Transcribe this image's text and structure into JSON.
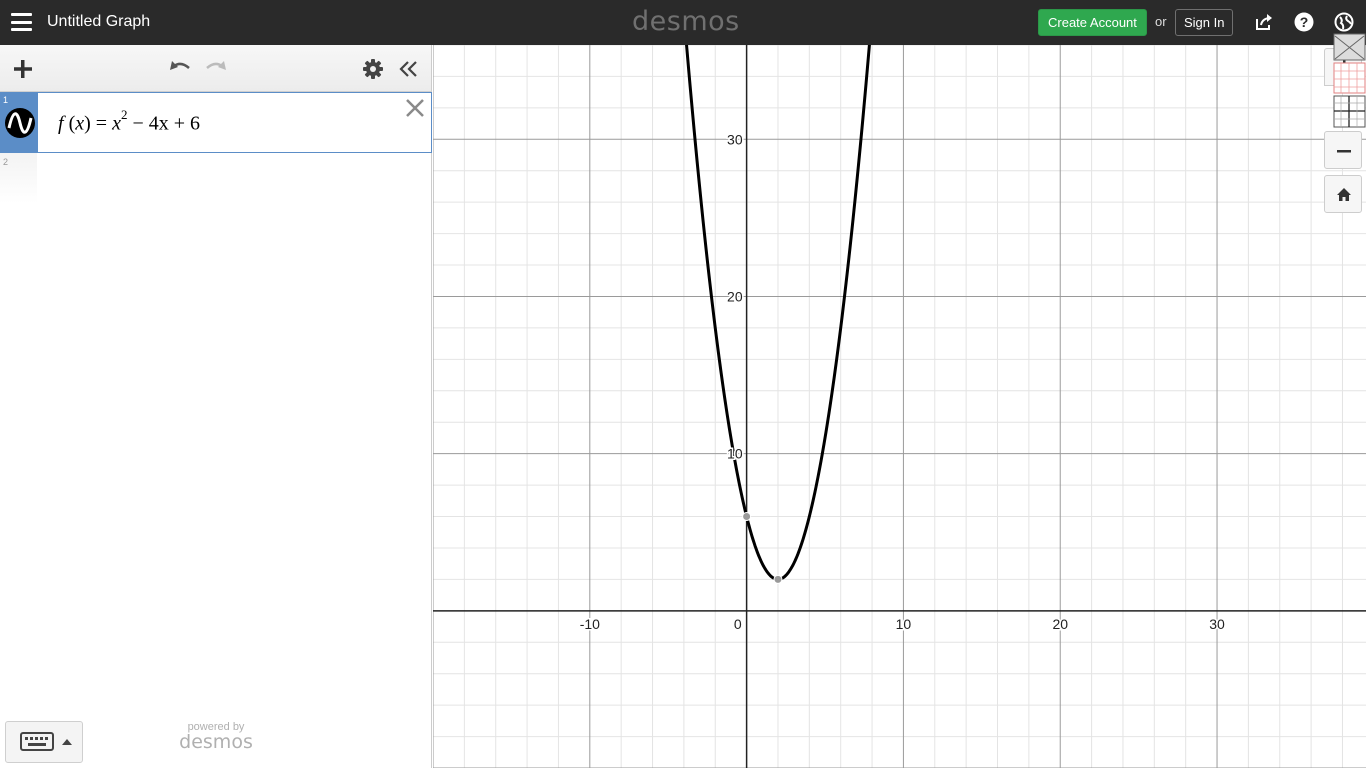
{
  "header": {
    "title": "Untitled Graph",
    "brand": "desmos",
    "create_account_label": "Create Account",
    "or_label": "or",
    "sign_in_label": "Sign In",
    "icons": [
      "hamburger-menu-icon",
      "share-icon",
      "help-icon",
      "globe-icon"
    ]
  },
  "panel": {
    "toolbar_icons": [
      "add-icon",
      "undo-icon",
      "redo-icon",
      "settings-gear-icon",
      "collapse-panel-icon"
    ],
    "expressions": [
      {
        "index": "1",
        "lhs": "f",
        "arg": "x",
        "base": "x",
        "exponent": "2",
        "rest": "− 4x + 6",
        "color": "#000000"
      },
      {
        "index": "2",
        "latex": ""
      }
    ],
    "footer": {
      "powered_by": "powered by",
      "brand": "desmos"
    }
  },
  "graph": {
    "zoom_buttons": [
      "zoom-in-icon",
      "zoom-out-icon",
      "home-icon"
    ],
    "accent_color": "#5b8dc7",
    "curve_color": "#000000",
    "point_color": "#999999"
  },
  "chart_data": {
    "type": "line",
    "title": "",
    "xlabel": "",
    "ylabel": "",
    "xlim": [
      -20,
      39.5
    ],
    "ylim": [
      -10,
      36
    ],
    "grid": true,
    "major_tick_step": 10,
    "minor_tick_step": 2,
    "x_tick_labels": [
      "-10",
      "0",
      "10",
      "20",
      "30"
    ],
    "y_tick_labels": [
      "10",
      "20",
      "30"
    ],
    "series": [
      {
        "expression": "x^2 - 4x + 6",
        "coefficients": [
          1,
          -4,
          6
        ],
        "color": "#000000"
      }
    ],
    "points": [
      {
        "x": 0,
        "y": 6
      },
      {
        "x": 2,
        "y": 2
      }
    ]
  }
}
